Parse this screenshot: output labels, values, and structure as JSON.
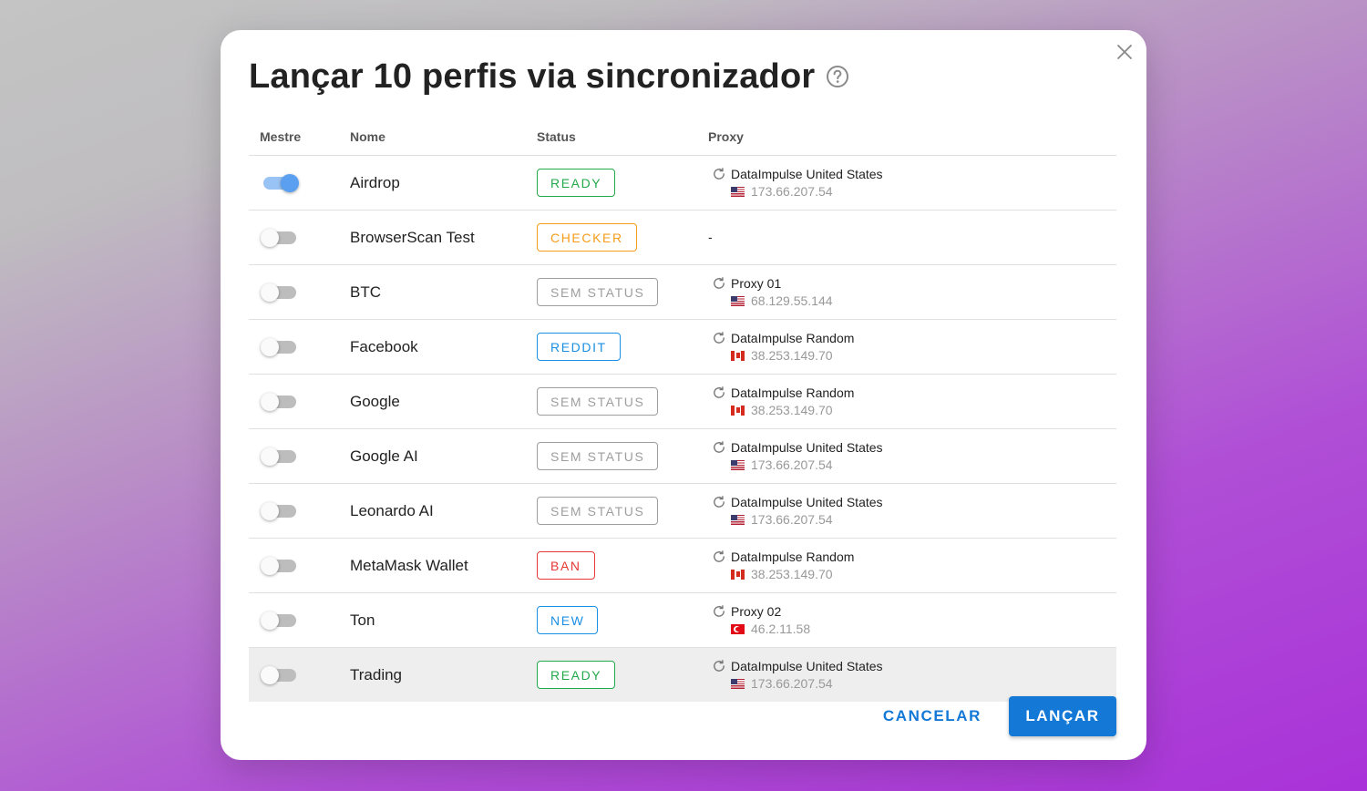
{
  "dialog": {
    "title": "Lançar 10 perfis via sincronizador",
    "help_icon": "help-circle-icon",
    "close_icon": "close-icon"
  },
  "columns": {
    "master": "Mestre",
    "name": "Nome",
    "status": "Status",
    "proxy": "Proxy"
  },
  "status_colors": {
    "READY": "#22a94a",
    "CHECKER": "#f59c1a",
    "SEM STATUS": "#9e9e9e",
    "REDDIT": "#1a8fe3",
    "BAN": "#e53935",
    "NEW": "#1a8fe3"
  },
  "rows": [
    {
      "master": true,
      "name": "Airdrop",
      "status": "READY",
      "proxy_name": "DataImpulse United States",
      "proxy_ip": "173.66.207.54",
      "flag": "us"
    },
    {
      "master": false,
      "name": "BrowserScan Test",
      "status": "CHECKER",
      "proxy_name": "-",
      "proxy_ip": "",
      "flag": ""
    },
    {
      "master": false,
      "name": "BTC",
      "status": "SEM STATUS",
      "proxy_name": "Proxy 01",
      "proxy_ip": "68.129.55.144",
      "flag": "us"
    },
    {
      "master": false,
      "name": "Facebook",
      "status": "REDDIT",
      "proxy_name": "DataImpulse Random",
      "proxy_ip": "38.253.149.70",
      "flag": "ca"
    },
    {
      "master": false,
      "name": "Google",
      "status": "SEM STATUS",
      "proxy_name": "DataImpulse Random",
      "proxy_ip": "38.253.149.70",
      "flag": "ca"
    },
    {
      "master": false,
      "name": "Google AI",
      "status": "SEM STATUS",
      "proxy_name": "DataImpulse United States",
      "proxy_ip": "173.66.207.54",
      "flag": "us"
    },
    {
      "master": false,
      "name": "Leonardo AI",
      "status": "SEM STATUS",
      "proxy_name": "DataImpulse United States",
      "proxy_ip": "173.66.207.54",
      "flag": "us"
    },
    {
      "master": false,
      "name": "MetaMask Wallet",
      "status": "BAN",
      "proxy_name": "DataImpulse Random",
      "proxy_ip": "38.253.149.70",
      "flag": "ca"
    },
    {
      "master": false,
      "name": "Ton",
      "status": "NEW",
      "proxy_name": "Proxy 02",
      "proxy_ip": "46.2.11.58",
      "flag": "tr"
    },
    {
      "master": false,
      "name": "Trading",
      "status": "READY",
      "proxy_name": "DataImpulse United States",
      "proxy_ip": "173.66.207.54",
      "flag": "us"
    }
  ],
  "footer": {
    "cancel_label": "CANCELAR",
    "launch_label": "LANÇAR"
  },
  "accent_color": "#1479d6"
}
